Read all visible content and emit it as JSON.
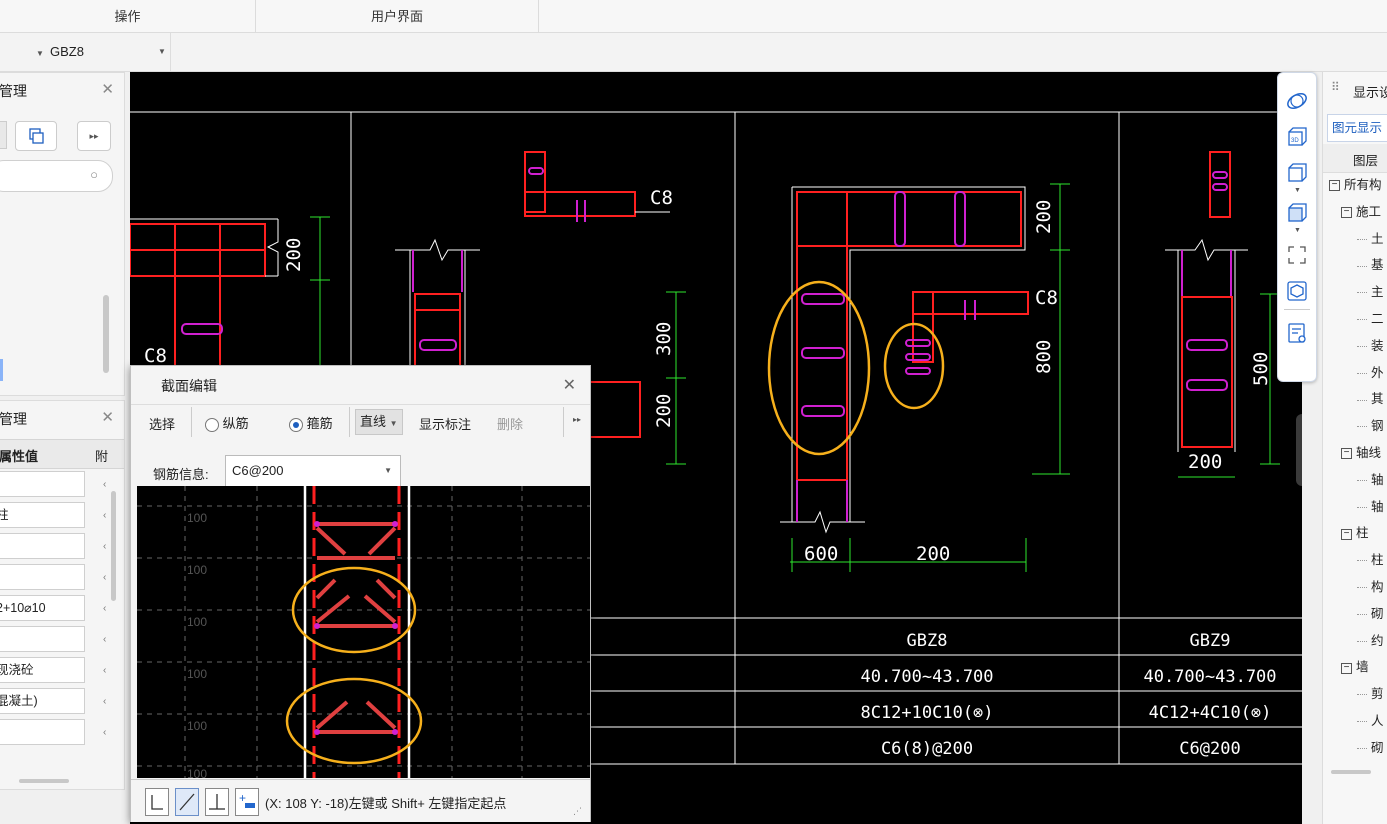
{
  "ribbon": {
    "groups": [
      "操作",
      "用户界面"
    ]
  },
  "selector": {
    "first_value": "",
    "second_value": "GBZ8"
  },
  "left_panel_top": {
    "title": "管理",
    "search_placeholder": ""
  },
  "left_panel_bottom": {
    "title": "管理",
    "header_value": "属性值",
    "header_extra": "附",
    "values": [
      "",
      "柱",
      "",
      "",
      "2+10⌀10",
      "",
      "现浇砼",
      "混凝土)",
      ""
    ]
  },
  "dialog": {
    "title": "截面编辑",
    "toolbar": {
      "select": "选择",
      "radio_longitudinal": "纵筋",
      "radio_stirrup": "箍筋",
      "line_mode": "直线",
      "show_annotation": "显示标注",
      "delete": "删除"
    },
    "rebar_label": "钢筋信息:",
    "rebar_value": "C6@200",
    "grid_labels": [
      "100",
      "100",
      "100",
      "100",
      "100",
      "100"
    ],
    "status_text": "(X: 108 Y: -18)左键或 Shift+ 左键指定起点"
  },
  "cad": {
    "dimensions": [
      "200",
      "300",
      "200",
      "200",
      "800",
      "500",
      "200",
      "600",
      "200"
    ],
    "bar_labels": [
      "C8",
      "C8",
      "C8"
    ],
    "table": {
      "names": [
        "GBZ8",
        "GBZ9"
      ],
      "elevations": [
        "40.700~43.700",
        "40.700~43.700"
      ],
      "longitudinal": [
        "8C12+10C10(⊗)",
        "4C12+4C10(⊗)"
      ],
      "stirrups": [
        "C6(8)@200",
        "C6@200"
      ]
    }
  },
  "right_panel": {
    "title": "显示设",
    "tab": "图元显示",
    "header": "图层",
    "tree": [
      {
        "label": "所有构",
        "level": 0,
        "box": "−"
      },
      {
        "label": "施工",
        "level": 1,
        "box": "−"
      },
      {
        "label": "土",
        "level": 2
      },
      {
        "label": "基",
        "level": 2
      },
      {
        "label": "主",
        "level": 2
      },
      {
        "label": "二",
        "level": 2
      },
      {
        "label": "装",
        "level": 2
      },
      {
        "label": "外",
        "level": 2
      },
      {
        "label": "其",
        "level": 2
      },
      {
        "label": "钢",
        "level": 2
      },
      {
        "label": "轴线",
        "level": 1,
        "box": "−"
      },
      {
        "label": "轴",
        "level": 2
      },
      {
        "label": "轴",
        "level": 2
      },
      {
        "label": "柱",
        "level": 1,
        "box": "−"
      },
      {
        "label": "柱",
        "level": 2
      },
      {
        "label": "构",
        "level": 2
      },
      {
        "label": "砌",
        "level": 2
      },
      {
        "label": "约",
        "level": 2
      },
      {
        "label": "墙",
        "level": 1,
        "box": "−"
      },
      {
        "label": "剪",
        "level": 2
      },
      {
        "label": "人",
        "level": 2
      },
      {
        "label": "砌",
        "level": 2
      }
    ]
  },
  "colors": {
    "highlight": "#f6b01c",
    "rebar": "#ff2020",
    "stirrup": "#d020d0",
    "dimension": "#2ee62e"
  }
}
